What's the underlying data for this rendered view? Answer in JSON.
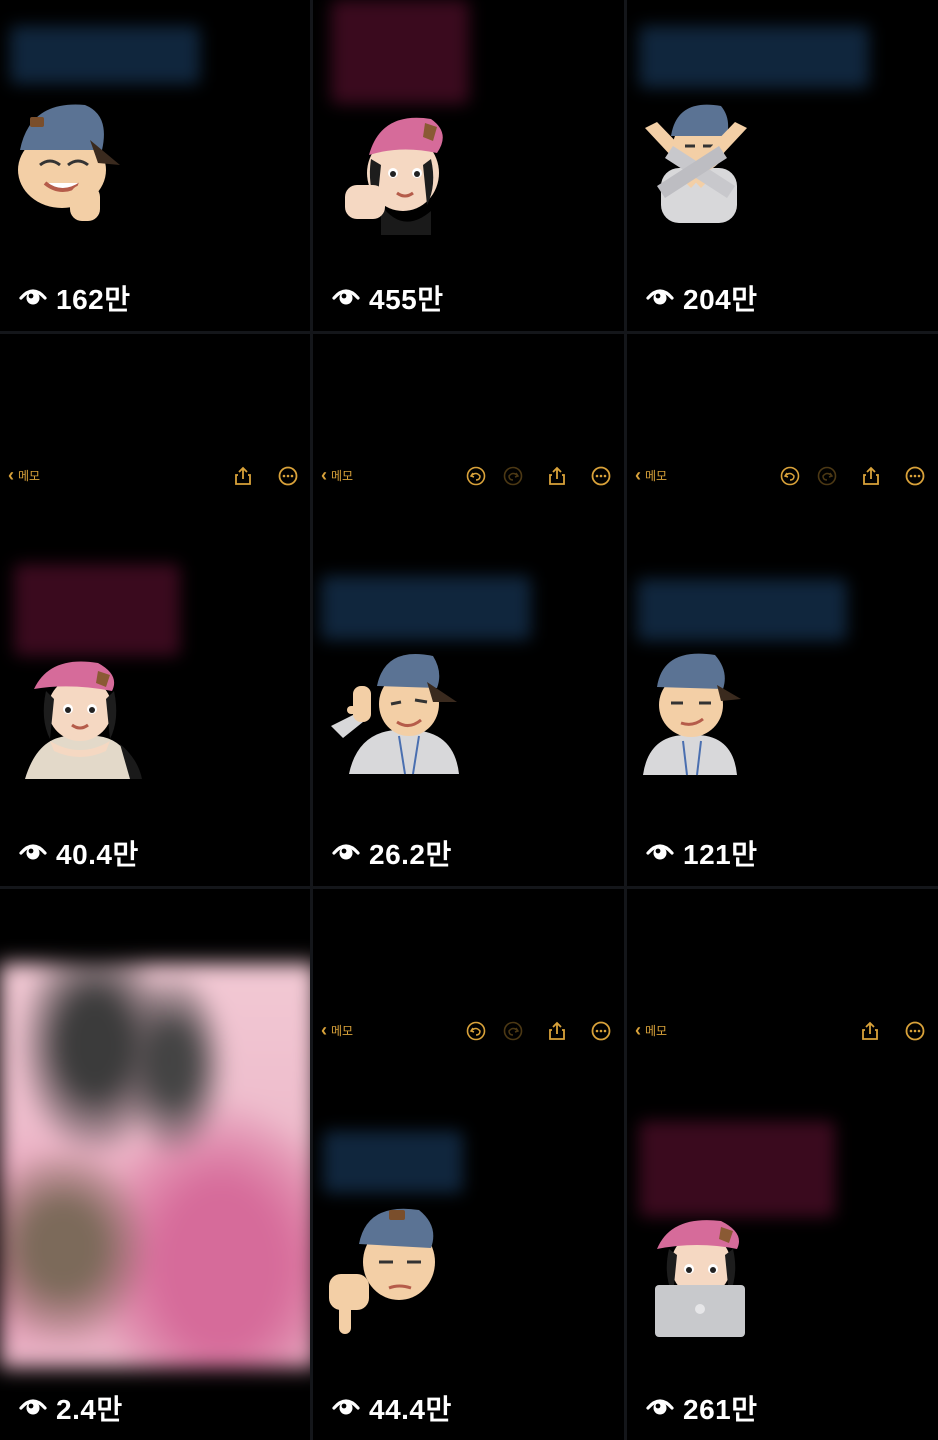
{
  "grid": {
    "cells": [
      {
        "views": "162만",
        "avatar": "cap-boy-finger-heart",
        "has_toolbar": false
      },
      {
        "views": "455만",
        "avatar": "beret-girl-fist",
        "has_toolbar": false
      },
      {
        "views": "204만",
        "avatar": "cap-boy-arms-crossed",
        "has_toolbar": false
      },
      {
        "views": "40.4만",
        "avatar": "beret-girl-hands-chin",
        "has_toolbar": true,
        "back_label": "메모"
      },
      {
        "views": "26.2만",
        "avatar": "cap-boy-call-me",
        "has_toolbar": true,
        "back_label": "메모"
      },
      {
        "views": "121만",
        "avatar": "cap-boy-smirk",
        "has_toolbar": true,
        "back_label": "메모"
      },
      {
        "views": "2.4만",
        "avatar": "blurred-image",
        "has_toolbar": false
      },
      {
        "views": "44.4만",
        "avatar": "cap-boy-thumbs-down",
        "has_toolbar": true,
        "back_label": "메모"
      },
      {
        "views": "261만",
        "avatar": "beret-girl-laptop",
        "has_toolbar": true,
        "back_label": "메모"
      }
    ]
  },
  "icons": {
    "views": "eye-icon",
    "back": "chevron-left-icon",
    "undo": "undo-icon",
    "redo": "redo-icon",
    "share": "share-icon",
    "more": "more-icon"
  },
  "colors": {
    "background": "#000000",
    "toolbar_accent": "#d9a23a",
    "view_text": "#ffffff"
  }
}
